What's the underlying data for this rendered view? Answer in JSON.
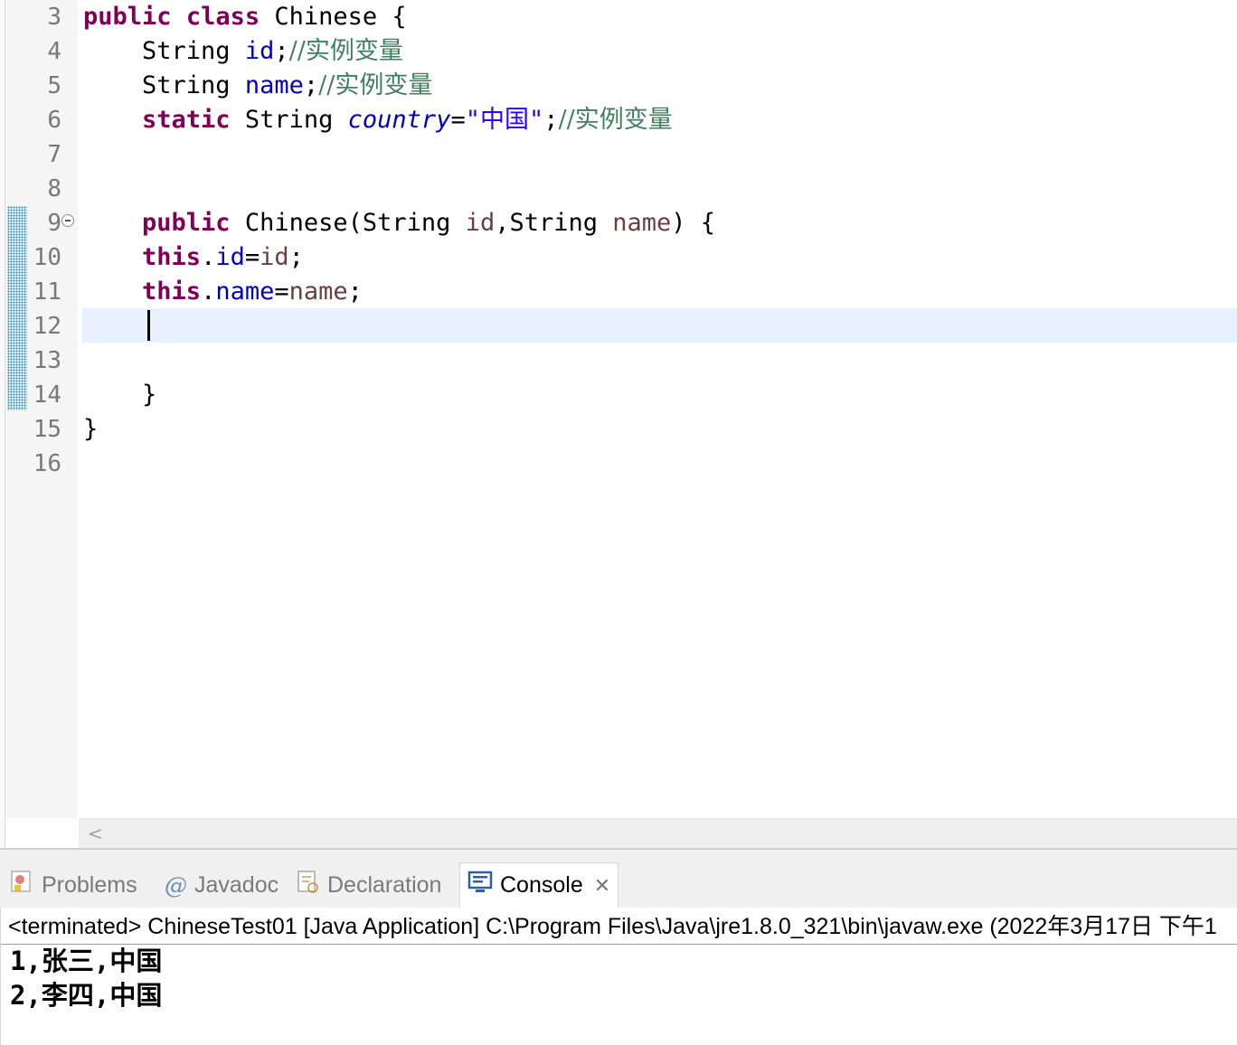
{
  "editor": {
    "line_numbers": [
      "3",
      "4",
      "5",
      "6",
      "7",
      "8",
      "9",
      "10",
      "11",
      "12",
      "13",
      "14",
      "15",
      "16"
    ],
    "code": {
      "l3": {
        "kw_public": "public",
        "kw_class": "class",
        "class_name": "Chinese",
        "brace": "{"
      },
      "l4": {
        "type": "String",
        "field": "id",
        "semi": ";",
        "comment": "//实例变量"
      },
      "l5": {
        "type": "String",
        "field": "name",
        "semi": ";",
        "comment": "//实例变量"
      },
      "l6": {
        "kw_static": "static",
        "type": "String",
        "field": "country",
        "eq": "=",
        "string": "\"中国\"",
        "semi": ";",
        "comment": "//实例变量"
      },
      "l9": {
        "kw_public": "public",
        "ctor": "Chinese(String",
        "param_id": "id",
        "comma_type": ",String",
        "param_name": "name",
        "close": ") {"
      },
      "l10": {
        "kw_this": "this",
        "dot": ".",
        "field": "id",
        "eq": "=",
        "param": "id",
        "semi": ";"
      },
      "l11": {
        "kw_this": "this",
        "dot": ".",
        "field": "name",
        "eq": "=",
        "param": "name",
        "semi": ";"
      },
      "l14": {
        "brace": "}"
      },
      "l15": {
        "brace": "}"
      }
    },
    "scroll_left": "<"
  },
  "bottom_panel": {
    "tabs": [
      {
        "label": "Problems",
        "icon": "problems-icon"
      },
      {
        "label": "Javadoc",
        "icon": "javadoc-icon",
        "glyph": "@"
      },
      {
        "label": "Declaration",
        "icon": "declaration-icon"
      },
      {
        "label": "Console",
        "icon": "console-icon",
        "active": true,
        "close": "✕"
      }
    ],
    "console": {
      "header": "<terminated> ChineseTest01 [Java Application] C:\\Program Files\\Java\\jre1.8.0_321\\bin\\javaw.exe (2022年3月17日 下午1",
      "output": [
        "1,张三,中国",
        "2,李四,中国"
      ]
    }
  },
  "colors": {
    "keyword": "#7f0055",
    "field": "#0000c0",
    "parameter": "#6a3e3e",
    "string": "#2a00ff",
    "comment": "#3f7f5f",
    "current_line": "#e8f2fe",
    "line_number": "#787878"
  }
}
